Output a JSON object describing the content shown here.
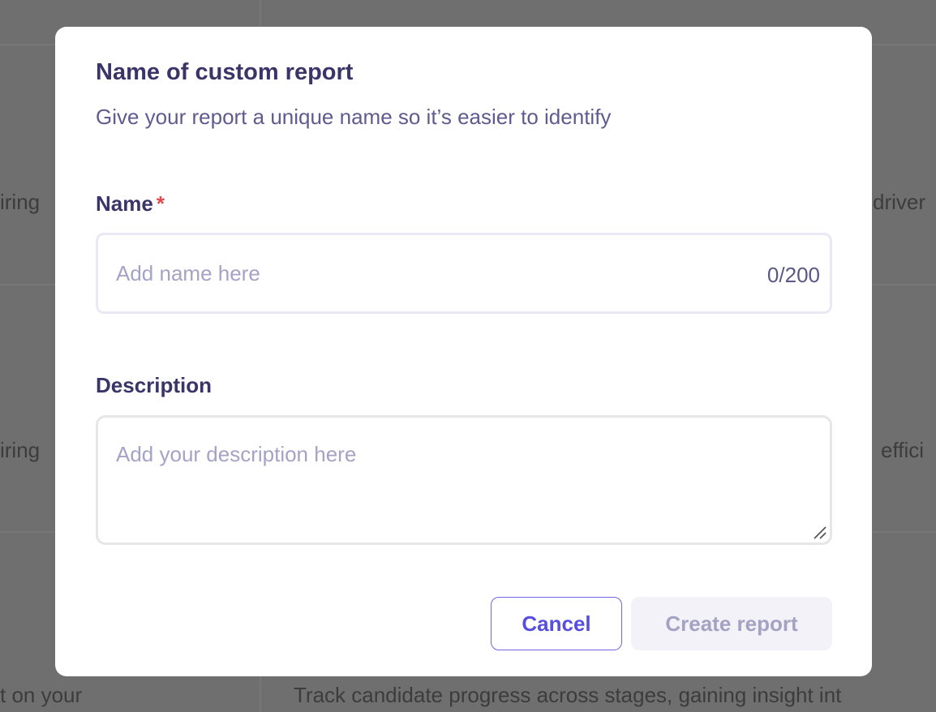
{
  "background": {
    "texts": [
      "iring",
      "driver",
      "iring",
      "effici",
      "t on your",
      "Track candidate progress across stages, gaining insight int"
    ]
  },
  "modal": {
    "title": "Name of custom report",
    "subtitle": "Give your report a unique name so it’s easier to identify",
    "name_field": {
      "label": "Name",
      "required_marker": "*",
      "placeholder": "Add name here",
      "value": "",
      "counter": "0/200"
    },
    "description_field": {
      "label": "Description",
      "placeholder": "Add your description here",
      "value": ""
    },
    "buttons": {
      "cancel_label": "Cancel",
      "create_label": "Create report"
    }
  },
  "colors": {
    "accent": "#574ee0",
    "title": "#3a3568",
    "required": "#e5484d",
    "overlay": "#6e6e6e"
  }
}
